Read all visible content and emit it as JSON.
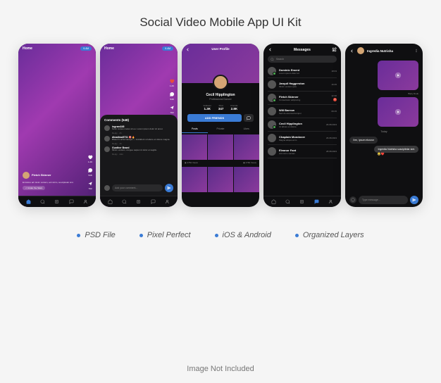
{
  "title": "Social Video Mobile App UI Kit",
  "features": [
    "PSD File",
    "Pixel Perfect",
    "iOS & Android",
    "Organized Layers"
  ],
  "footer_note": "Image Not Included",
  "colors": {
    "accent": "#3a7bd5",
    "bg_dark": "#0f0f11"
  },
  "screen1": {
    "header_label": "Home",
    "badge": "9.4M",
    "user_name": "Fletch Skinner",
    "desc": "Et dolore ad minim veniam, ad minim, suscipitelar sint.",
    "music": "♫ Under the Stars",
    "like_count": "1.2K",
    "comment_count": "548",
    "share_count": "793"
  },
  "screen2": {
    "header_label": "Home",
    "badge": "9.4M",
    "comments_title": "Comments (548)",
    "comments": [
      {
        "user": "ingram345",
        "text": "Nunc cursus metus sit eu. Lorem ipsum dolor sit amet.",
        "meta": "Reply · 2h"
      },
      {
        "user": "dinadiwa5731 🎯🔥",
        "text": "Bhaut hi acha banaya — incididunt ut labore et dolore magna.",
        "meta": "Reply · 1h"
      },
      {
        "user": "Gunther Beard",
        "text": "Minim veniam, congue sapien id dolor et sagitis.",
        "meta": "Reply · 44m"
      }
    ],
    "input_placeholder": "Add your comment...",
    "like_count": "1.2K",
    "comment_count": "548",
    "share_count": "793"
  },
  "screen3": {
    "title": "User Profile",
    "name": "Cecil Hipplington",
    "subtitle": "Professional Dancer",
    "stats": {
      "followers_label": "Follower",
      "followers": "1.3K",
      "posts_label": "Post",
      "posts": "347",
      "friends_label": "Friends",
      "friends": "2.8K"
    },
    "follow_btn": "ADD FRIENDS",
    "tabs": [
      "Posts",
      "Private",
      "Likes"
    ],
    "views1": "◉ 4782 Views",
    "views2": "◉ 4782 Views"
  },
  "screen4": {
    "title": "Messages",
    "search_placeholder": "Search",
    "items": [
      {
        "name": "Dominic Ement",
        "sub": "Lorem ipsum dolor sit",
        "time": "18:03",
        "online": true
      },
      {
        "name": "Jarquil Haggerston",
        "sub": "Minim veniam quis",
        "time": "16:45"
      },
      {
        "name": "Fletch Skinner",
        "sub": "Consectetur adipiscing",
        "time": "12:30",
        "online": true,
        "unread": "2"
      },
      {
        "name": "Will Barrow",
        "sub": "Sed do eiusmod tempor",
        "time": "09:15"
      },
      {
        "name": "Cecil Hipplington",
        "sub": "Ut labore et dolore",
        "time": "29.08.2023",
        "online": true
      },
      {
        "name": "Chaplain Mondover",
        "sub": "Magna aliqua enim",
        "time": "29.08.2023"
      },
      {
        "name": "Eleanor Fant",
        "sub": "Ad minim veniam",
        "time": "28.08.2023"
      }
    ]
  },
  "screen5": {
    "name": "Ingredia Nutrisha",
    "day": "Today",
    "incoming": "Xen, ipsum elusnor",
    "outgoing": "Ingredia Nutrisha suscipitelar sint.",
    "caption": "Tue · 2:45pm",
    "input_placeholder": "Type message..."
  }
}
